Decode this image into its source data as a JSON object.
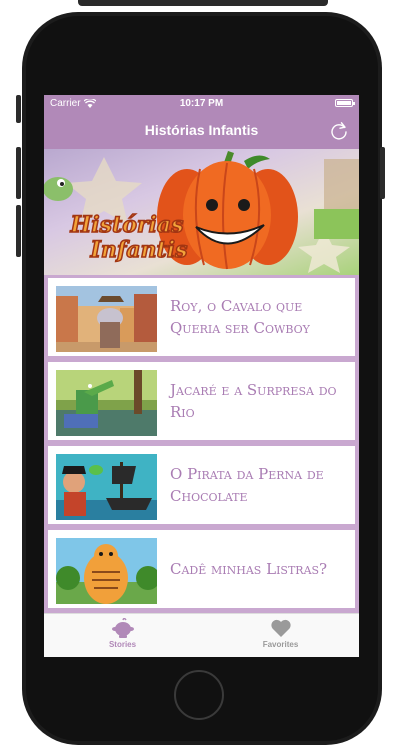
{
  "status_bar": {
    "carrier": "Carrier",
    "time": "10:17 PM"
  },
  "nav": {
    "title": "Histórias Infantis",
    "refresh_icon": "refresh-icon"
  },
  "banner": {
    "logo_line1": "Histórias",
    "logo_line2": "Infantis"
  },
  "stories": [
    {
      "title": "Roy, o Cavalo que Queria ser Cowboy"
    },
    {
      "title": "Jacaré e a Surpresa do Rio"
    },
    {
      "title": "O Pirata da Perna de Chocolate"
    },
    {
      "title": "Cadê minhas Listras?"
    }
  ],
  "tabbar": {
    "stories_label": "Stories",
    "favorites_label": "Favorites"
  },
  "colors": {
    "accent": "#b189b8",
    "title_text": "#a97cb3"
  }
}
